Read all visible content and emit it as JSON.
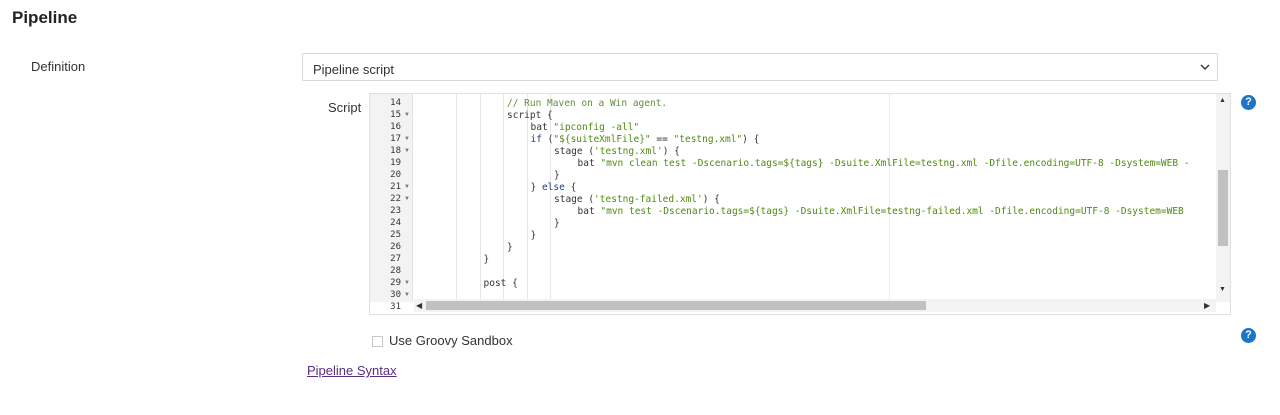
{
  "section": {
    "title": "Pipeline"
  },
  "definition": {
    "label": "Definition",
    "selected": "Pipeline script"
  },
  "script": {
    "label": "Script",
    "editor": {
      "lines": [
        {
          "num": "14",
          "fold": false,
          "indent": 2,
          "tokens": [
            {
              "t": "// Run Maven on a Win agent.",
              "c": "comment"
            }
          ]
        },
        {
          "num": "15",
          "fold": true,
          "indent": 2,
          "tokens": [
            {
              "t": "script {",
              "c": "plain"
            }
          ]
        },
        {
          "num": "16",
          "fold": false,
          "indent": 3,
          "tokens": [
            {
              "t": "bat ",
              "c": "plain"
            },
            {
              "t": "\"ipconfig -all\"",
              "c": "str"
            }
          ]
        },
        {
          "num": "17",
          "fold": true,
          "indent": 3,
          "tokens": [
            {
              "t": "if",
              "c": "kw"
            },
            {
              "t": " (",
              "c": "plain"
            },
            {
              "t": "\"${suiteXmlFile}\"",
              "c": "str"
            },
            {
              "t": " == ",
              "c": "plain"
            },
            {
              "t": "\"testng.xml\"",
              "c": "str"
            },
            {
              "t": ") {",
              "c": "plain"
            }
          ]
        },
        {
          "num": "18",
          "fold": true,
          "indent": 4,
          "tokens": [
            {
              "t": "stage (",
              "c": "plain"
            },
            {
              "t": "'testng.xml'",
              "c": "str"
            },
            {
              "t": ") {",
              "c": "plain"
            }
          ]
        },
        {
          "num": "19",
          "fold": false,
          "indent": 5,
          "tokens": [
            {
              "t": "bat ",
              "c": "plain"
            },
            {
              "t": "\"mvn clean test -Dscenario.tags=${tags} -Dsuite.XmlFile=testng.xml -Dfile.encoding=UTF-8 -Dsystem=WEB -",
              "c": "str"
            }
          ]
        },
        {
          "num": "20",
          "fold": false,
          "indent": 4,
          "tokens": [
            {
              "t": "}",
              "c": "plain"
            }
          ]
        },
        {
          "num": "21",
          "fold": true,
          "indent": 3,
          "tokens": [
            {
              "t": "} ",
              "c": "plain"
            },
            {
              "t": "else",
              "c": "kw"
            },
            {
              "t": " {",
              "c": "plain"
            }
          ]
        },
        {
          "num": "22",
          "fold": true,
          "indent": 4,
          "tokens": [
            {
              "t": "stage (",
              "c": "plain"
            },
            {
              "t": "'testng-failed.xml'",
              "c": "str"
            },
            {
              "t": ") {",
              "c": "plain"
            }
          ]
        },
        {
          "num": "23",
          "fold": false,
          "indent": 5,
          "tokens": [
            {
              "t": "bat ",
              "c": "plain"
            },
            {
              "t": "\"mvn test -Dscenario.tags=${tags} -Dsuite.XmlFile=testng-failed.xml -Dfile.encoding=UTF-8 -Dsystem=WEB",
              "c": "str"
            }
          ]
        },
        {
          "num": "24",
          "fold": false,
          "indent": 4,
          "tokens": [
            {
              "t": "}",
              "c": "plain"
            }
          ]
        },
        {
          "num": "25",
          "fold": false,
          "indent": 3,
          "tokens": [
            {
              "t": "}",
              "c": "plain"
            }
          ]
        },
        {
          "num": "26",
          "fold": false,
          "indent": 2,
          "tokens": [
            {
              "t": "}",
              "c": "plain"
            }
          ]
        },
        {
          "num": "27",
          "fold": false,
          "indent": 1,
          "tokens": [
            {
              "t": "}",
              "c": "plain"
            }
          ]
        },
        {
          "num": "28",
          "fold": false,
          "indent": 0,
          "tokens": []
        },
        {
          "num": "29",
          "fold": true,
          "indent": 1,
          "tokens": [
            {
              "t": "post {",
              "c": "plain"
            }
          ]
        },
        {
          "num": "30",
          "fold": true,
          "indent": 2,
          "tokens": []
        },
        {
          "num": "31",
          "fold": false,
          "indent": 0,
          "tokens": []
        }
      ]
    }
  },
  "sandbox": {
    "label": "Use Groovy Sandbox",
    "checked": false
  },
  "link": {
    "label": "Pipeline Syntax"
  },
  "help": {
    "glyph": "?"
  },
  "colors": {
    "accent": "#1c75c6",
    "link": "#5a2d82",
    "comment": "#5f8f3b",
    "string": "#4e8a0f",
    "keyword": "#1d3e8a"
  }
}
